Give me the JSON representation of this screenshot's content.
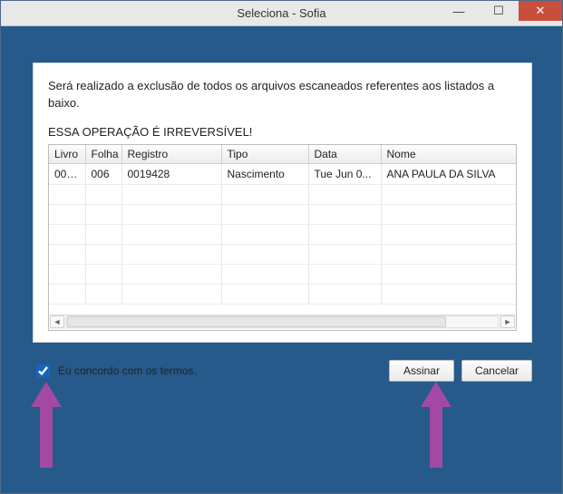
{
  "window": {
    "title": "Seleciona - Sofia"
  },
  "dialog": {
    "message": "Será realizado a exclusão de todos os arquivos escaneados referentes aos listados a baixo.",
    "warning": "ESSA OPERAÇÃO É IRREVERSÍVEL!"
  },
  "table": {
    "headers": {
      "livro": "Livro",
      "folha": "Folha",
      "registro": "Registro",
      "tipo": "Tipo",
      "data": "Data",
      "nome": "Nome"
    },
    "rows": [
      {
        "livro": "000...",
        "folha": "006",
        "registro": "0019428",
        "tipo": "Nascimento",
        "data": "Tue Jun 0...",
        "nome": "ANA PAULA DA SILVA"
      }
    ]
  },
  "footer": {
    "agree_label": "Eu concordo com os termos.",
    "agree_checked": true,
    "sign_label": "Assinar",
    "cancel_label": "Cancelar"
  },
  "colors": {
    "accent": "#255a8a",
    "close": "#c94f3d",
    "arrow": "#a349a4"
  }
}
